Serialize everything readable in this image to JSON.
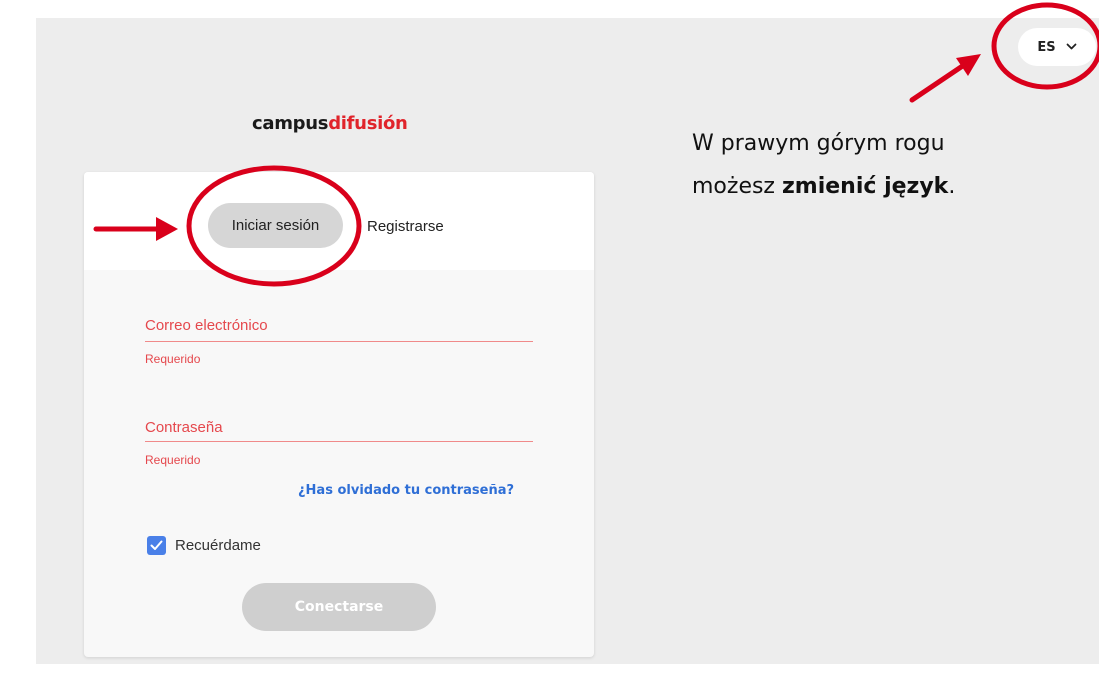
{
  "language_selector": {
    "value": "ES",
    "icon": "chevron-down-icon"
  },
  "logo": {
    "part1": "campus",
    "part2": "difusión"
  },
  "tabs": {
    "login": "Iniciar sesión",
    "register": "Registrarse"
  },
  "form": {
    "email_label": "Correo electrónico",
    "email_error": "Requerido",
    "password_label": "Contraseña",
    "password_error": "Requerido",
    "forgot_link": "¿Has olvidado tu contraseña?",
    "remember_label": "Recuérdame",
    "remember_checked": true,
    "submit_label": "Conectarse"
  },
  "annotation": {
    "line1": "W prawym górym rogu",
    "line2_prefix": "możesz ",
    "line2_bold": "zmienić język",
    "line2_suffix": "."
  },
  "colors": {
    "accent_red": "#e0242b",
    "error_red": "#e5484d",
    "link_blue": "#2f6fd6",
    "checkbox_blue": "#4a80e8",
    "annotation_red": "#d9001b"
  }
}
